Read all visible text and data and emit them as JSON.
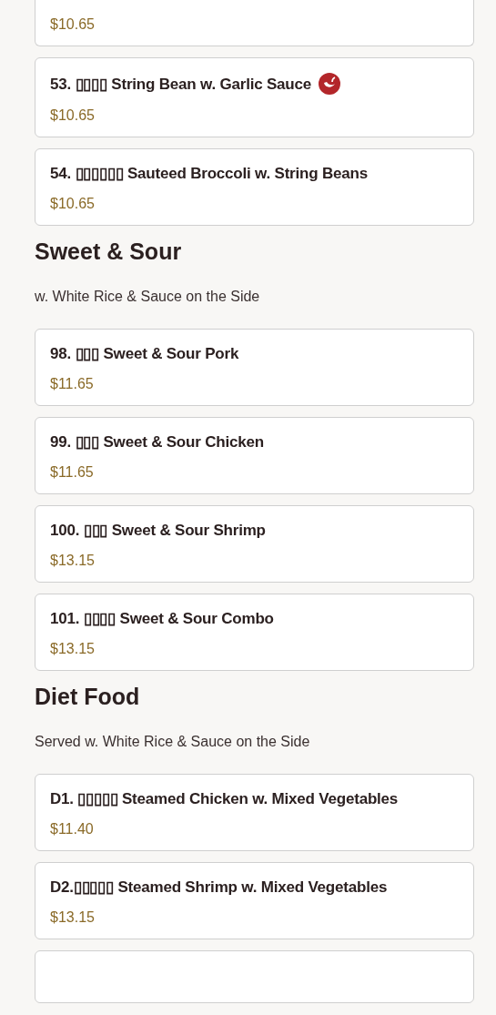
{
  "sections": [
    {
      "items": [
        {
          "price": "$10.65",
          "spicy": false
        },
        {
          "title": "53. ▯▯▯▯ String Bean w. Garlic Sauce",
          "price": "$10.65",
          "spicy": true
        },
        {
          "title": "54. ▯▯▯▯▯▯ Sauteed Broccoli w. String Beans",
          "price": "$10.65",
          "spicy": false
        }
      ]
    },
    {
      "heading": "Sweet & Sour",
      "note": "w. White Rice & Sauce on the Side",
      "items": [
        {
          "title": "98. ▯▯▯ Sweet & Sour Pork",
          "price": "$11.65",
          "spicy": false
        },
        {
          "title": "99. ▯▯▯ Sweet & Sour Chicken",
          "price": "$11.65",
          "spicy": false
        },
        {
          "title": "100. ▯▯▯ Sweet & Sour Shrimp",
          "price": "$13.15",
          "spicy": false
        },
        {
          "title": "101. ▯▯▯▯ Sweet & Sour Combo",
          "price": "$13.15",
          "spicy": false
        }
      ]
    },
    {
      "heading": "Diet Food",
      "note": "Served w. White Rice & Sauce on the Side",
      "items": [
        {
          "title": "D1. ▯▯▯▯▯ Steamed Chicken w. Mixed Vegetables",
          "price": "$11.40",
          "spicy": false
        },
        {
          "title": "D2.▯▯▯▯▯ Steamed Shrimp w. Mixed Vegetables",
          "price": "$13.15",
          "spicy": false
        }
      ]
    }
  ]
}
